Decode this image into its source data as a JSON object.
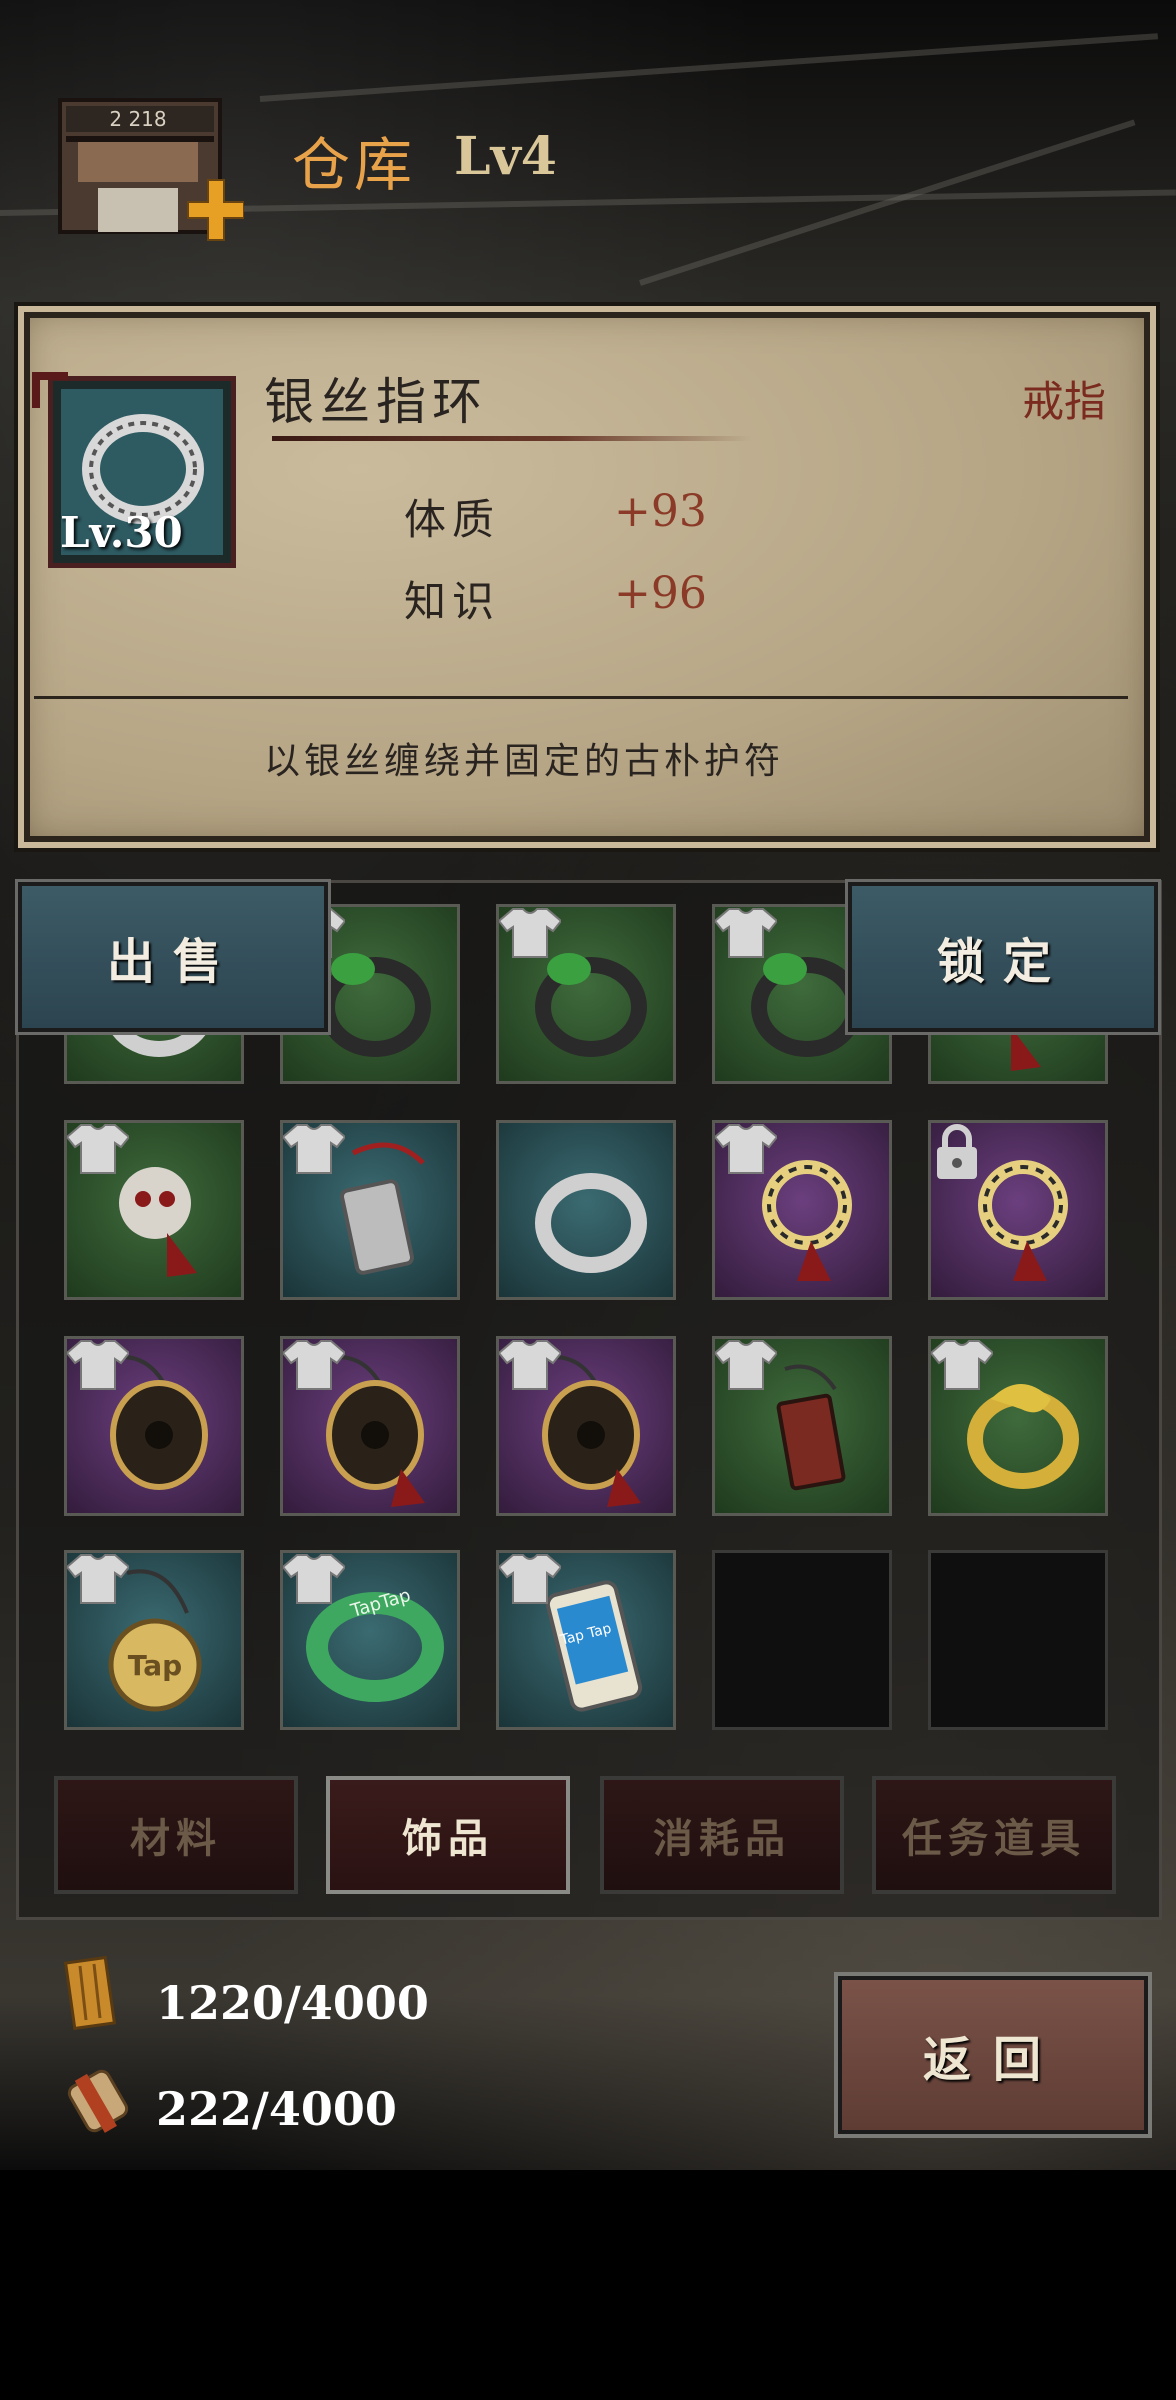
{
  "header": {
    "title": "仓库",
    "level": "Lv4",
    "building_sign": "2 218"
  },
  "item": {
    "name": "银丝指环",
    "type": "戒指",
    "level": "Lv.30",
    "stats": [
      {
        "name": "体质",
        "value": "+93"
      },
      {
        "name": "知识",
        "value": "+96"
      }
    ],
    "description": "以银丝缠绕并固定的古朴护符"
  },
  "actions": {
    "sell": "出售",
    "lock": "锁定"
  },
  "grid": {
    "rows": [
      [
        {
          "rarity": "green",
          "icon": "ring-icon",
          "equipped": false,
          "locked": false
        },
        {
          "rarity": "green",
          "icon": "jade-dragon-ring-icon",
          "equipped": true,
          "locked": false
        },
        {
          "rarity": "green",
          "icon": "jade-dragon-ring-icon",
          "equipped": true,
          "locked": false
        },
        {
          "rarity": "green",
          "icon": "jade-dragon-ring-icon",
          "equipped": true,
          "locked": false
        },
        {
          "rarity": "green",
          "icon": "pendant-icon",
          "equipped": false,
          "locked": false
        }
      ],
      [
        {
          "rarity": "green",
          "icon": "beast-skull-charm-icon",
          "equipped": true,
          "locked": false
        },
        {
          "rarity": "teal",
          "icon": "silver-tag-charm-icon",
          "equipped": true,
          "locked": false
        },
        {
          "rarity": "teal",
          "icon": "silver-ring-icon",
          "equipped": false,
          "locked": false
        },
        {
          "rarity": "purple",
          "icon": "gold-hoop-charm-icon",
          "equipped": true,
          "locked": false
        },
        {
          "rarity": "purple",
          "icon": "gold-hoop-charm-icon",
          "equipped": false,
          "locked": true
        }
      ],
      [
        {
          "rarity": "purple",
          "icon": "ornate-disc-pendant-icon",
          "equipped": true,
          "locked": false
        },
        {
          "rarity": "purple",
          "icon": "ornate-disc-tassel-icon",
          "equipped": true,
          "locked": false
        },
        {
          "rarity": "purple",
          "icon": "ornate-disc-tassel-icon",
          "equipped": true,
          "locked": false
        },
        {
          "rarity": "green",
          "icon": "amulet-tag-icon",
          "equipped": true,
          "locked": false
        },
        {
          "rarity": "green",
          "icon": "gold-dragon-ring-icon",
          "equipped": true,
          "locked": false
        }
      ],
      [
        {
          "rarity": "teal",
          "icon": "tap-gold-medal-icon",
          "equipped": true,
          "locked": false
        },
        {
          "rarity": "teal",
          "icon": "jade-bangle-icon",
          "equipped": true,
          "locked": false
        },
        {
          "rarity": "teal",
          "icon": "taptap-phone-icon",
          "equipped": true,
          "locked": false
        },
        {
          "rarity": "empty",
          "icon": "",
          "equipped": false,
          "locked": false
        },
        {
          "rarity": "empty",
          "icon": "",
          "equipped": false,
          "locked": false
        }
      ]
    ],
    "labels": {
      "medal": "Tap",
      "bangle": "TapTap",
      "phone": "Tap Tap"
    }
  },
  "tabs": [
    {
      "label": "材料",
      "active": false
    },
    {
      "label": "饰品",
      "active": true
    },
    {
      "label": "消耗品",
      "active": false
    },
    {
      "label": "任务道具",
      "active": false
    }
  ],
  "resources": [
    {
      "icon": "wood-plank-icon",
      "value": "1220/4000"
    },
    {
      "icon": "cloth-bundle-icon",
      "value": "222/4000"
    }
  ],
  "back_button": "返回",
  "colors": {
    "accent_title": "#e8a24a",
    "rarity_green": "#3f6b3c",
    "rarity_teal": "#3b6b72",
    "rarity_purple": "#6b3f7e",
    "stat_value": "#8a3a26"
  }
}
